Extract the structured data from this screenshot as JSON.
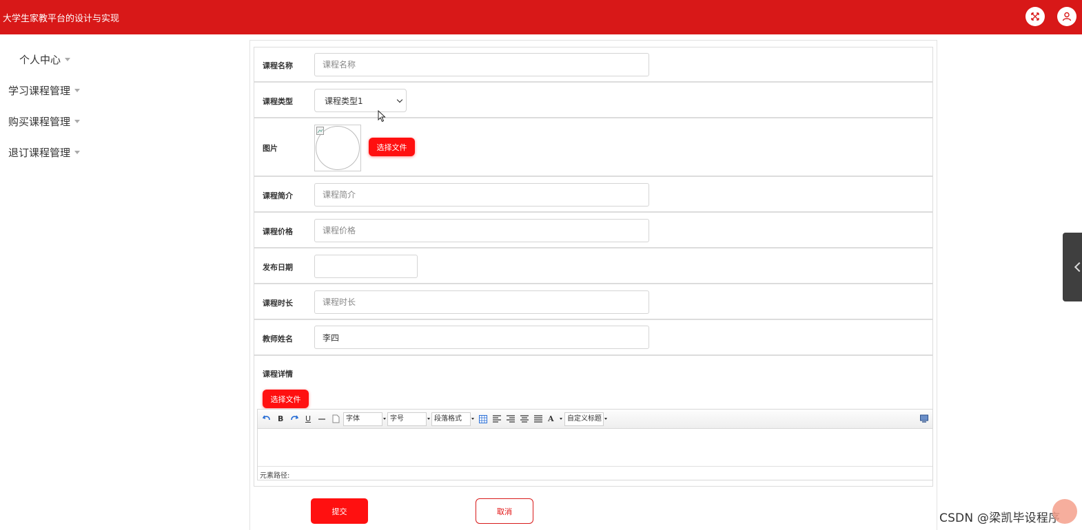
{
  "header": {
    "title": "大学生家教平台的设计与实现"
  },
  "sidebar": {
    "items": [
      {
        "label": "个人中心"
      },
      {
        "label": "学习课程管理"
      },
      {
        "label": "购买课程管理"
      },
      {
        "label": "退订课程管理"
      }
    ]
  },
  "form": {
    "course_name": {
      "label": "课程名称",
      "placeholder": "课程名称",
      "value": ""
    },
    "course_type": {
      "label": "课程类型",
      "selected": "课程类型1"
    },
    "image": {
      "label": "图片",
      "button": "选择文件"
    },
    "intro": {
      "label": "课程简介",
      "placeholder": "课程简介",
      "value": ""
    },
    "price": {
      "label": "课程价格",
      "placeholder": "课程价格",
      "value": ""
    },
    "publish_date": {
      "label": "发布日期",
      "value": ""
    },
    "duration": {
      "label": "课程时长",
      "placeholder": "课程时长",
      "value": ""
    },
    "teacher": {
      "label": "教师姓名",
      "value": "李四"
    },
    "detail": {
      "label": "课程详情",
      "button": "选择文件"
    }
  },
  "editor": {
    "toolbar": {
      "bold": "B",
      "underline": "U",
      "font_family": "字体",
      "font_size": "字号",
      "paragraph": "段落格式",
      "font_color": "A",
      "custom_title": "自定义标题"
    },
    "status": "元素路径:"
  },
  "actions": {
    "submit": "提交",
    "cancel": "取消"
  },
  "watermark": "CSDN @梁凯毕设程序",
  "colors": {
    "primary": "#d81818",
    "button": "#ff1010"
  }
}
